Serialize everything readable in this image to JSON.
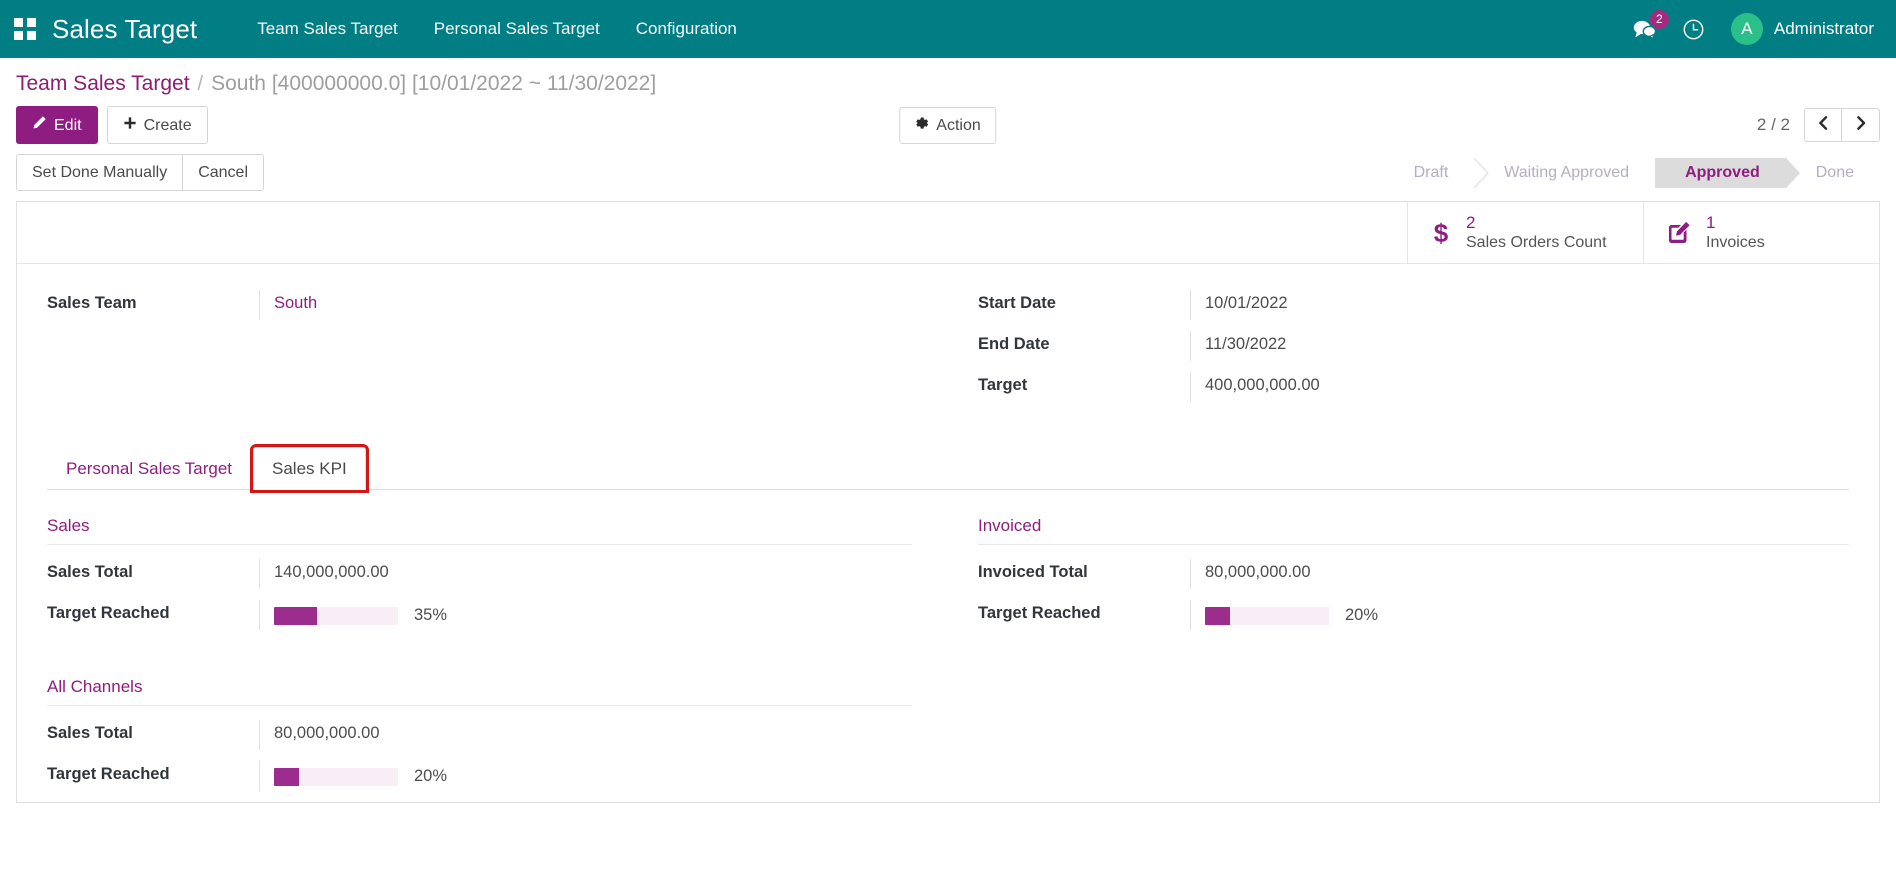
{
  "navbar": {
    "apps_icon": "apps-grid-icon",
    "brand": "Sales Target",
    "menu": [
      {
        "label": "Team Sales Target"
      },
      {
        "label": "Personal Sales Target"
      },
      {
        "label": "Configuration"
      }
    ],
    "messages_icon": "chat-bubble-icon",
    "messages_count": "2",
    "activity_icon": "clock-icon",
    "avatar_initial": "A",
    "user_name": "Administrator"
  },
  "breadcrumb": {
    "root": "Team Sales Target",
    "separator": "/",
    "current": "South [400000000.0] [10/01/2022 ~ 11/30/2022]"
  },
  "control_bar": {
    "edit_label": "Edit",
    "edit_icon": "pencil-icon",
    "create_label": "Create",
    "create_icon": "plus-icon",
    "action_label": "Action",
    "action_icon": "gear-icon",
    "pager_text": "2 / 2",
    "prev_icon": "chevron-left-icon",
    "next_icon": "chevron-right-icon"
  },
  "statusbar": {
    "buttons": [
      {
        "label": "Set Done Manually"
      },
      {
        "label": "Cancel"
      }
    ],
    "stages": [
      {
        "label": "Draft",
        "active": false
      },
      {
        "label": "Waiting Approved",
        "active": false
      },
      {
        "label": "Approved",
        "active": true
      },
      {
        "label": "Done",
        "active": false
      }
    ]
  },
  "stat_buttons": [
    {
      "icon": "dollar-sign-icon",
      "value": "2",
      "label": "Sales Orders Count"
    },
    {
      "icon": "pencil-square-icon",
      "value": "1",
      "label": "Invoices"
    }
  ],
  "form": {
    "left": [
      {
        "label": "Sales Team",
        "value": "South",
        "link": true
      }
    ],
    "right": [
      {
        "label": "Start Date",
        "value": "10/01/2022"
      },
      {
        "label": "End Date",
        "value": "11/30/2022"
      },
      {
        "label": "Target",
        "value": "400,000,000.00"
      }
    ]
  },
  "notebook": {
    "tabs": [
      {
        "label": "Personal Sales Target",
        "active": false,
        "highlighted": false
      },
      {
        "label": "Sales KPI",
        "active": true,
        "highlighted": true
      }
    ]
  },
  "kpi": {
    "sales": {
      "title": "Sales",
      "total_label": "Sales Total",
      "total_value": "140,000,000.00",
      "reached_label": "Target Reached",
      "reached_text": "35%",
      "reached_percent": 35
    },
    "invoiced": {
      "title": "Invoiced",
      "total_label": "Invoiced Total",
      "total_value": "80,000,000.00",
      "reached_label": "Target Reached",
      "reached_text": "20%",
      "reached_percent": 20
    },
    "all_channels": {
      "title": "All Channels",
      "total_label": "Sales Total",
      "total_value": "80,000,000.00",
      "reached_label": "Target Reached",
      "reached_text": "20%",
      "reached_percent": 20
    }
  },
  "colors": {
    "navbar_teal": "#017e84",
    "accent_purple": "#8f1c80",
    "progress_fill": "#9c2d8f",
    "progress_track": "#faeef6",
    "badge_pink": "#a32b7f",
    "avatar_green": "#2bbf8a",
    "highlight_red": "#d31616"
  }
}
